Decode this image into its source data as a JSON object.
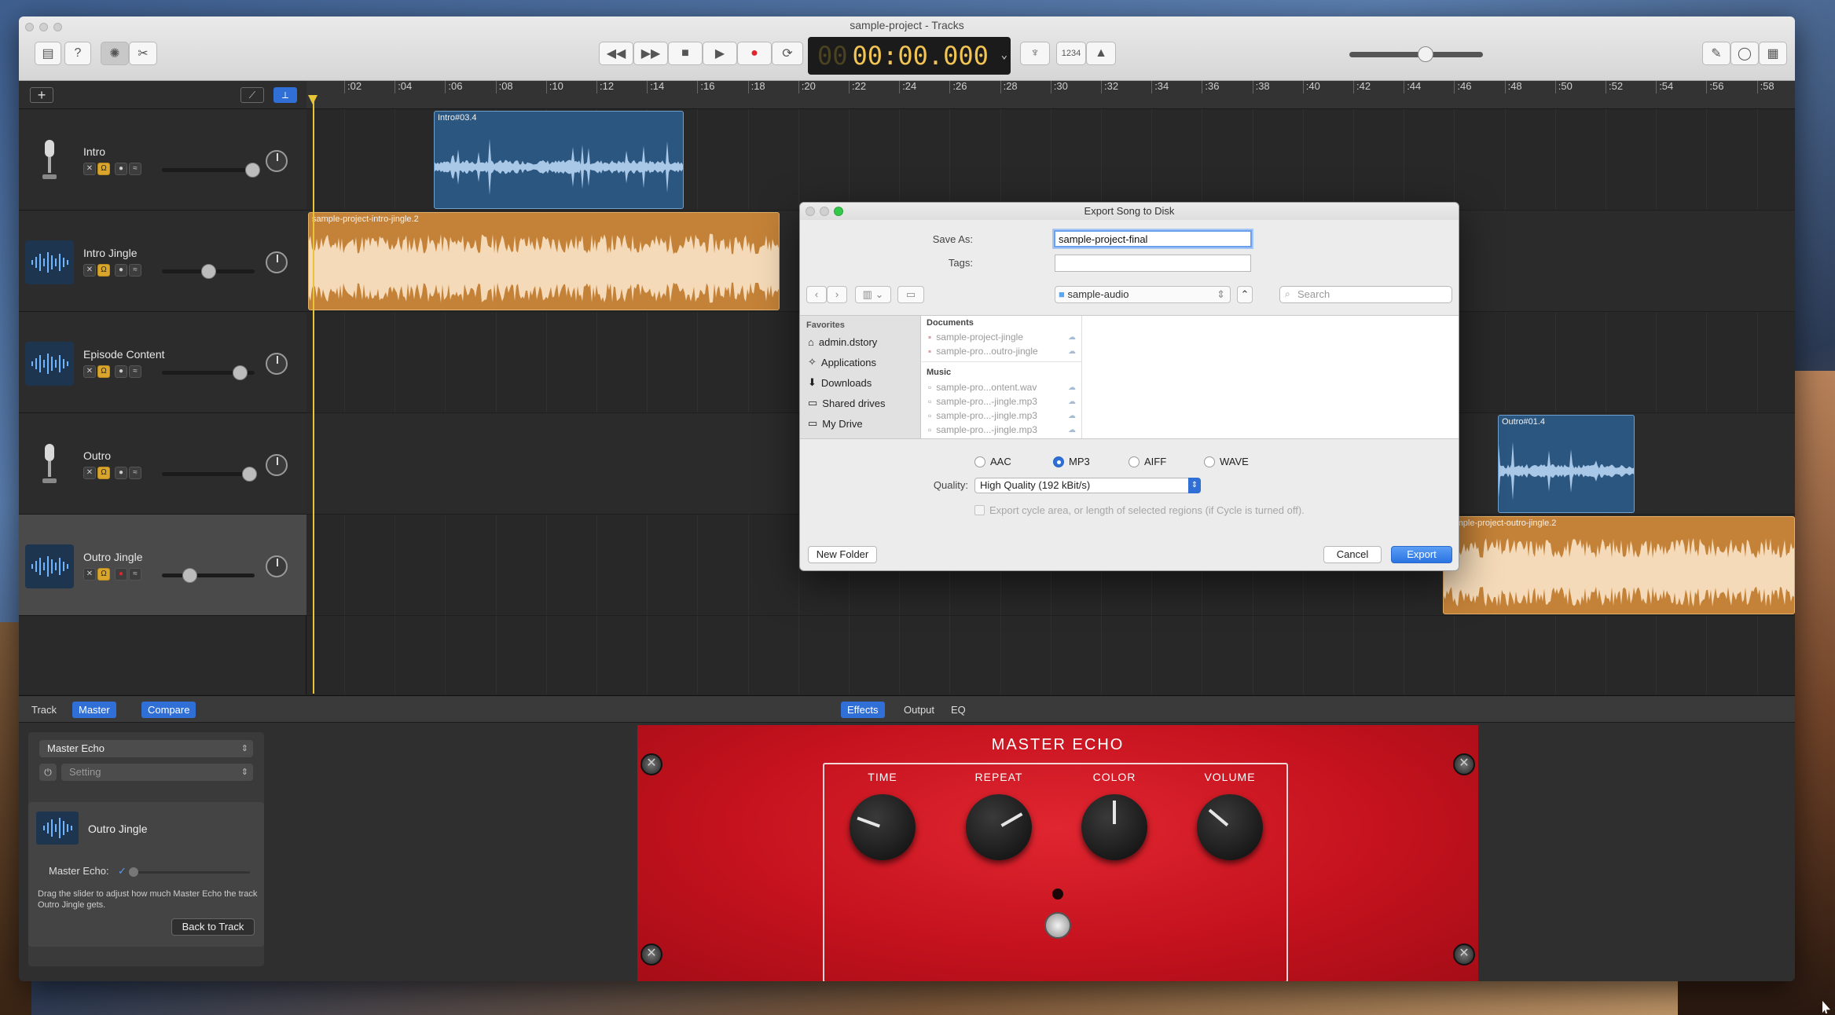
{
  "window": {
    "title": "sample-project - Tracks",
    "lcd_dim": "00",
    "lcd_time": "00:00.000",
    "count_in_label": "1234"
  },
  "ruler": {
    "ticks": [
      ":02",
      ":04",
      ":06",
      ":08",
      ":10",
      ":12",
      ":14",
      ":16",
      ":18",
      ":20",
      ":22",
      ":24",
      ":26",
      ":28",
      ":30",
      ":32",
      ":34",
      ":36",
      ":38",
      ":40",
      ":42",
      ":44",
      ":46",
      ":48",
      ":50",
      ":52",
      ":54",
      ":56",
      ":58"
    ]
  },
  "tracks": [
    {
      "name": "Intro",
      "icon": "microphone-icon",
      "volume": 0.93
    },
    {
      "name": "Intro Jingle",
      "icon": "waveform-icon",
      "volume": 0.43
    },
    {
      "name": "Episode Content",
      "icon": "waveform-icon",
      "volume": 0.79
    },
    {
      "name": "Outro",
      "icon": "microphone-icon",
      "volume": 0.88
    },
    {
      "name": "Outro Jingle",
      "icon": "waveform-icon",
      "volume": 0.22
    }
  ],
  "regions": {
    "intro": "Intro#03.4",
    "intro_jingle": "sample-project-intro-jingle.2",
    "outro": "Outro#01.4",
    "outro_jingle": "sample-project-outro-jingle.2"
  },
  "smart": {
    "tabs_left": [
      "Track",
      "Master",
      "Compare"
    ],
    "tabs_center": [
      "Effects",
      "Output",
      "EQ"
    ],
    "preset": "Master Echo",
    "setting": "Setting",
    "track_name": "Outro Jingle",
    "echo_label": "Master Echo:",
    "help_text": "Drag the slider to adjust how much Master Echo the track Outro Jingle gets.",
    "back_button": "Back to Track",
    "pedal_title": "MASTER ECHO",
    "knobs": [
      "TIME",
      "REPEAT",
      "COLOR",
      "VOLUME"
    ]
  },
  "dialog": {
    "title": "Export Song to Disk",
    "save_as_label": "Save As:",
    "save_as_value": "sample-project-final",
    "tags_label": "Tags:",
    "tags_value": "",
    "location": "sample-audio",
    "search_placeholder": "Search",
    "favorites_head": "Favorites",
    "favorites": [
      "admin.dstory",
      "Applications",
      "Downloads",
      "Shared drives",
      "My Drive"
    ],
    "documents_head": "Documents",
    "documents": [
      "sample-project-jingle",
      "sample-pro...outro-jingle"
    ],
    "music_head": "Music",
    "music": [
      "sample-pro...ontent.wav",
      "sample-pro...-jingle.mp3",
      "sample-pro...-jingle.mp3",
      "sample-pro...-jingle.mp3"
    ],
    "formats": [
      "AAC",
      "MP3",
      "AIFF",
      "WAVE"
    ],
    "selected_format": "MP3",
    "quality_label": "Quality:",
    "quality_value": "High Quality (192 kBit/s)",
    "cycle_label": "Export cycle area, or length of selected regions (if Cycle is turned off).",
    "new_folder": "New Folder",
    "cancel": "Cancel",
    "export": "Export"
  },
  "colors": {
    "accent": "#2f6fd6",
    "lcd": "#f1c453",
    "region_blue": "#2a5680",
    "region_orange": "#c48238",
    "pedal_red": "#c4121e"
  }
}
